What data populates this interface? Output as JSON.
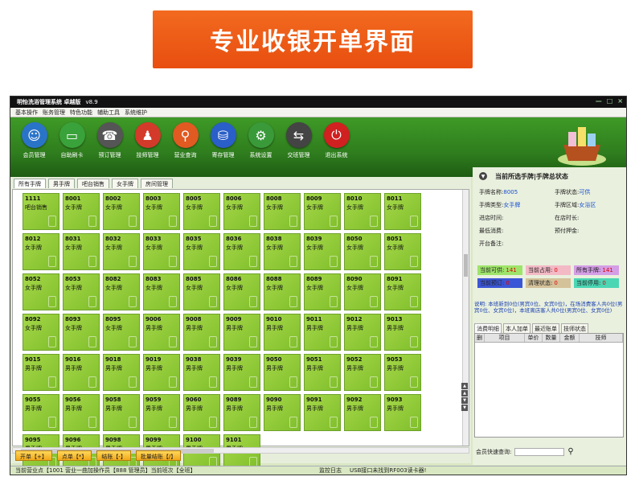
{
  "banner": "专业收银开单界面",
  "window": {
    "title": "明怡洗浴管理系统 卓越版",
    "version": "v8.9",
    "controls": [
      "—",
      "□",
      "×"
    ]
  },
  "menu": [
    "基本操作",
    "账务管理",
    "特色功能",
    "辅助工具",
    "系统维护"
  ],
  "toolbar": [
    {
      "label": "会员管理",
      "icon": "member-icon",
      "color": "#2a74c8",
      "glyph": "☺"
    },
    {
      "label": "自助刷卡",
      "icon": "card-icon",
      "color": "#3aa23a",
      "glyph": "▭"
    },
    {
      "label": "预订管理",
      "icon": "phone-icon",
      "color": "#555555",
      "glyph": "☎"
    },
    {
      "label": "技师管理",
      "icon": "technician-icon",
      "color": "#d43a2a",
      "glyph": "♟"
    },
    {
      "label": "营业查询",
      "icon": "magnifier-icon",
      "color": "#e05a22",
      "glyph": "⚲"
    },
    {
      "label": "寄存管理",
      "icon": "bag-icon",
      "color": "#2a5ec8",
      "glyph": "⛁"
    },
    {
      "label": "系统设置",
      "icon": "gear-icon",
      "color": "#3a9a3a",
      "glyph": "⚙"
    },
    {
      "label": "交班管理",
      "icon": "handover-icon",
      "color": "#444444",
      "glyph": "⇆"
    },
    {
      "label": "退出系统",
      "icon": "power-icon",
      "color": "#d02020",
      "glyph": "⏻"
    }
  ],
  "tabs": [
    "所有手牌",
    "男手牌",
    "吧台销售",
    "女手牌",
    "房间管理"
  ],
  "cards": [
    {
      "num": "1111",
      "kind": "吧台销售"
    },
    {
      "num": "8001",
      "kind": "女手牌"
    },
    {
      "num": "8002",
      "kind": "女手牌"
    },
    {
      "num": "8003",
      "kind": "女手牌"
    },
    {
      "num": "8005",
      "kind": "女手牌"
    },
    {
      "num": "8006",
      "kind": "女手牌"
    },
    {
      "num": "8008",
      "kind": "女手牌"
    },
    {
      "num": "8009",
      "kind": "女手牌"
    },
    {
      "num": "8010",
      "kind": "女手牌"
    },
    {
      "num": "8011",
      "kind": "女手牌"
    },
    {
      "num": "8012",
      "kind": "女手牌"
    },
    {
      "num": "8031",
      "kind": "女手牌"
    },
    {
      "num": "8032",
      "kind": "女手牌"
    },
    {
      "num": "8033",
      "kind": "女手牌"
    },
    {
      "num": "8035",
      "kind": "女手牌"
    },
    {
      "num": "8036",
      "kind": "女手牌"
    },
    {
      "num": "8038",
      "kind": "女手牌"
    },
    {
      "num": "8039",
      "kind": "女手牌"
    },
    {
      "num": "8050",
      "kind": "女手牌"
    },
    {
      "num": "8051",
      "kind": "女手牌"
    },
    {
      "num": "8052",
      "kind": "女手牌"
    },
    {
      "num": "8053",
      "kind": "女手牌"
    },
    {
      "num": "8082",
      "kind": "女手牌"
    },
    {
      "num": "8083",
      "kind": "女手牌"
    },
    {
      "num": "8085",
      "kind": "女手牌"
    },
    {
      "num": "8086",
      "kind": "女手牌"
    },
    {
      "num": "8088",
      "kind": "女手牌"
    },
    {
      "num": "8089",
      "kind": "女手牌"
    },
    {
      "num": "8090",
      "kind": "女手牌"
    },
    {
      "num": "8091",
      "kind": "女手牌"
    },
    {
      "num": "8092",
      "kind": "女手牌"
    },
    {
      "num": "8093",
      "kind": "女手牌"
    },
    {
      "num": "8095",
      "kind": "女手牌"
    },
    {
      "num": "9006",
      "kind": "男手牌"
    },
    {
      "num": "9008",
      "kind": "男手牌"
    },
    {
      "num": "9009",
      "kind": "男手牌"
    },
    {
      "num": "9010",
      "kind": "男手牌"
    },
    {
      "num": "9011",
      "kind": "男手牌"
    },
    {
      "num": "9012",
      "kind": "男手牌"
    },
    {
      "num": "9013",
      "kind": "男手牌"
    },
    {
      "num": "9015",
      "kind": "男手牌"
    },
    {
      "num": "9016",
      "kind": "男手牌"
    },
    {
      "num": "9018",
      "kind": "男手牌"
    },
    {
      "num": "9019",
      "kind": "男手牌"
    },
    {
      "num": "9038",
      "kind": "男手牌"
    },
    {
      "num": "9039",
      "kind": "男手牌"
    },
    {
      "num": "9050",
      "kind": "男手牌"
    },
    {
      "num": "9051",
      "kind": "男手牌"
    },
    {
      "num": "9052",
      "kind": "男手牌"
    },
    {
      "num": "9053",
      "kind": "男手牌"
    },
    {
      "num": "9055",
      "kind": "男手牌"
    },
    {
      "num": "9056",
      "kind": "男手牌"
    },
    {
      "num": "9058",
      "kind": "男手牌"
    },
    {
      "num": "9059",
      "kind": "男手牌"
    },
    {
      "num": "9060",
      "kind": "男手牌"
    },
    {
      "num": "9089",
      "kind": "男手牌"
    },
    {
      "num": "9090",
      "kind": "男手牌"
    },
    {
      "num": "9091",
      "kind": "男手牌"
    },
    {
      "num": "9092",
      "kind": "男手牌"
    },
    {
      "num": "9093",
      "kind": "男手牌"
    },
    {
      "num": "9095",
      "kind": "男手牌"
    },
    {
      "num": "9096",
      "kind": "男手牌"
    },
    {
      "num": "9098",
      "kind": "男手牌"
    },
    {
      "num": "9099",
      "kind": "男手牌"
    },
    {
      "num": "9100",
      "kind": "男手牌"
    },
    {
      "num": "9101",
      "kind": "男手牌"
    }
  ],
  "buttons": {
    "open": "开单【+】",
    "order": "点单【*】",
    "settle": "结账【-】",
    "batch": "批量结账【/】"
  },
  "right": {
    "title": "当前所选手牌|手牌总状态",
    "fields": [
      {
        "label": "手牌名称:",
        "value": "8005"
      },
      {
        "label": "手牌状态:",
        "value": "可供"
      },
      {
        "label": "手牌类型:",
        "value": "女手牌"
      },
      {
        "label": "手牌区域:",
        "value": "女浴区"
      },
      {
        "label": "进店时间:",
        "value": ""
      },
      {
        "label": "在店时长:",
        "value": ""
      },
      {
        "label": "最低消费:",
        "value": ""
      },
      {
        "label": "预付押金:",
        "value": ""
      },
      {
        "label": "开台备注:",
        "value": ""
      },
      {
        "label": "",
        "value": ""
      }
    ],
    "stats": [
      {
        "label": "当前可供:",
        "value": "141",
        "bg": "#9ee46a"
      },
      {
        "label": "当前占用:",
        "value": "0",
        "bg": "#f3b9c5"
      },
      {
        "label": "所有手牌:",
        "value": "141",
        "bg": "#d49ee6"
      },
      {
        "label": "当前预订:",
        "value": "0",
        "bg": "#3a56d6"
      },
      {
        "label": "清理状态:",
        "value": "0",
        "bg": "#d4c29a"
      },
      {
        "label": "当前停用:",
        "value": "0",
        "bg": "#4bd6b4"
      }
    ],
    "note": "说明: 本班新到0位(男宾0位、女宾0位)，在场消费客人共0位(男宾0位、女宾0位)，本班离店客人共0位(男宾0位、女宾0位)",
    "tabs": [
      "消费明细",
      "本人加单",
      "最近账单",
      "技师状态"
    ],
    "table_headers": [
      "删",
      "项目",
      "单价",
      "数量",
      "金额",
      "技师"
    ],
    "search_label": "会员快速查询:"
  },
  "status": {
    "left": "当前营业点【1001 营业一曲加操作员【888 管理员】当前班次【全班】",
    "middle": "监控日志",
    "right": "USB接口未找到RF003读卡器!"
  }
}
